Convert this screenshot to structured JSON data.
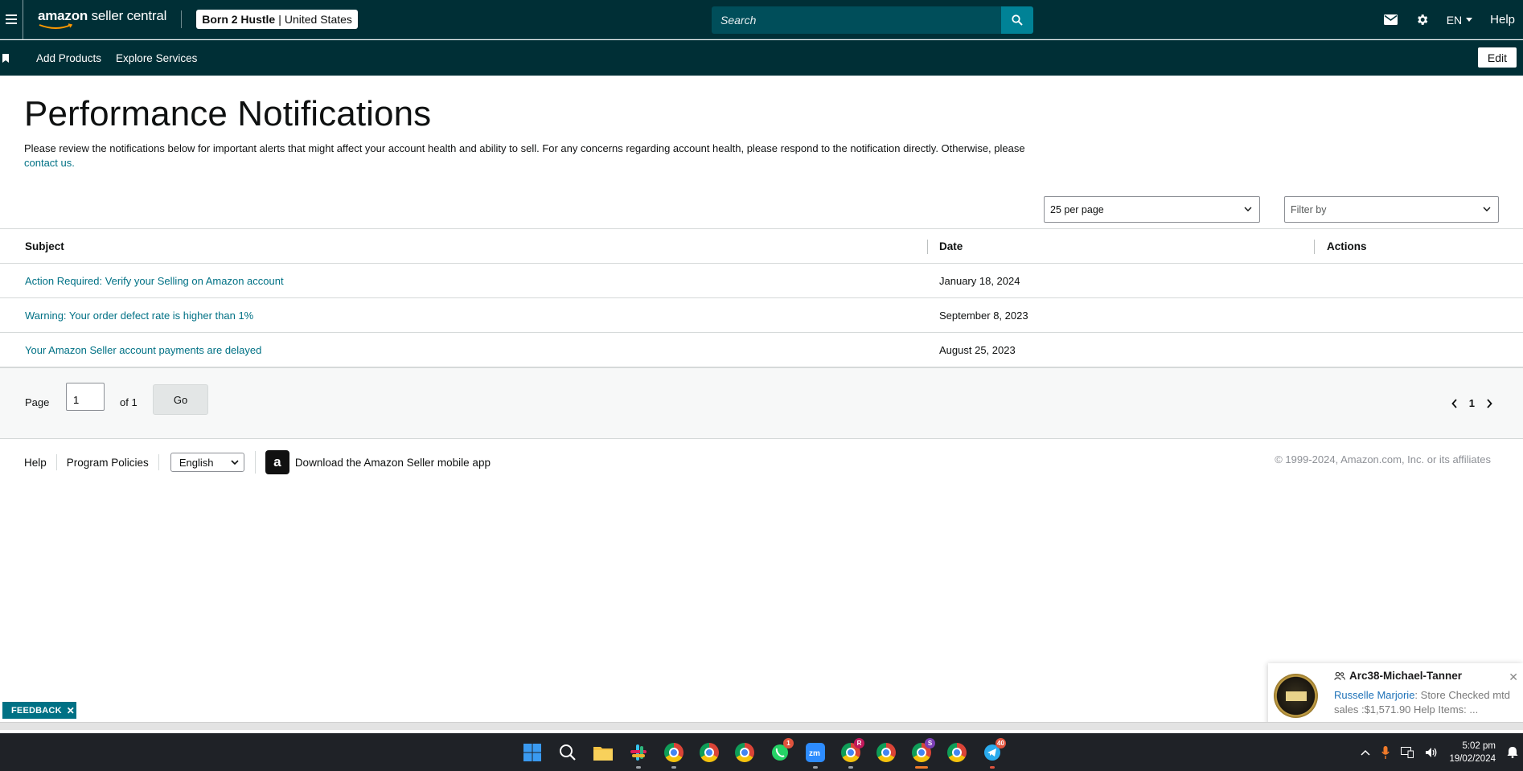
{
  "header": {
    "logo_brand": "amazon",
    "logo_suffix": " seller central",
    "store_name": "Born 2 Hustle",
    "store_separator": "|",
    "store_region": "United States",
    "search_placeholder": "Search",
    "language": "EN",
    "help": "Help"
  },
  "subnav": {
    "items": [
      "Add Products",
      "Explore Services"
    ],
    "edit": "Edit"
  },
  "page": {
    "title": "Performance Notifications",
    "desc_text": "Please review the notifications below for important alerts that might affect your account health and ability to sell. For any concerns regarding account health, please respond to the notification directly. Otherwise, please ",
    "desc_link": "contact us."
  },
  "controls": {
    "per_page": "25 per page",
    "filter_placeholder": "Filter by"
  },
  "table": {
    "headers": [
      "Subject",
      "Date",
      "Actions"
    ],
    "rows": [
      {
        "subject": "Action Required: Verify your Selling on Amazon account",
        "date": "January 18, 2024"
      },
      {
        "subject": "Warning: Your order defect rate is higher than 1%",
        "date": "September 8, 2023"
      },
      {
        "subject": "Your Amazon Seller account payments are delayed",
        "date": "August 25, 2023"
      }
    ]
  },
  "pagination": {
    "page_label": "Page",
    "page_value": "1",
    "of_label": "of 1",
    "go": "Go",
    "current": "1"
  },
  "footer": {
    "help": "Help",
    "policies": "Program Policies",
    "language": "English",
    "app_text": "Download the Amazon Seller mobile app",
    "copyright": "© 1999-2024, Amazon.com, Inc. or its affiliates"
  },
  "toast": {
    "title": "Arc38-Michael-Tanner",
    "sender": "Russelle Marjorie",
    "message": ": Store Checked mtd sales :$1,571.90 Help Items: ..."
  },
  "feedback": "FEEDBACK",
  "taskbar": {
    "time": "5:02 pm",
    "date": "19/02/2024",
    "badges": {
      "whatsapp": "1",
      "chrome_r": "R",
      "chrome_s": "S",
      "telegram": "40"
    }
  },
  "colors": {
    "header_bg": "#002f36",
    "accent": "#008296",
    "link": "#007185"
  }
}
